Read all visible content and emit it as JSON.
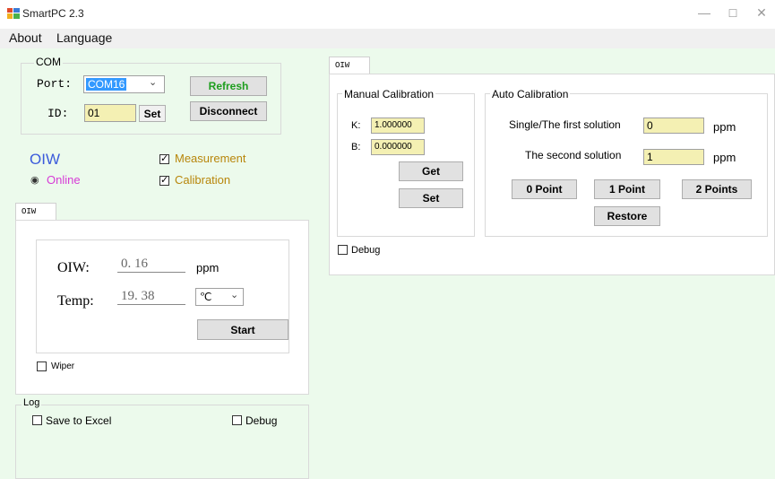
{
  "window": {
    "title": "SmartPC 2.3",
    "minimize_glyph": "—",
    "maximize_glyph": "☐",
    "close_glyph": "✕"
  },
  "menu": [
    "About",
    "Language"
  ],
  "com": {
    "group_label": "COM",
    "port_label": "Port:",
    "port_value": "COM16",
    "id_label": "ID:",
    "id_value": "01",
    "set_label": "Set",
    "refresh_label": "Refresh",
    "disconnect_label": "Disconnect"
  },
  "status": {
    "device_name": "OIW",
    "online_label": "Online",
    "measurement_label": "Measurement",
    "calibration_label": "Calibration"
  },
  "left_tab": {
    "tab_label": "OIW",
    "oiw_label": "OIW:",
    "oiw_value": "0. 16",
    "oiw_unit": "ppm",
    "temp_label": "Temp:",
    "temp_value": "19. 38",
    "temp_unit": "℃",
    "start_label": "Start",
    "wiper_label": "Wiper"
  },
  "log": {
    "group_label": "Log",
    "save_excel_label": "Save to Excel",
    "debug_label": "Debug"
  },
  "right_tab": {
    "tab_label": "OIW",
    "manual": {
      "group_label": "Manual Calibration",
      "k_label": "K:",
      "k_value": "1.000000",
      "b_label": "B:",
      "b_value": "0.000000",
      "get_label": "Get",
      "set_label": "Set"
    },
    "auto": {
      "group_label": "Auto Calibration",
      "first_label": "Single/The first solution",
      "first_value": "0",
      "first_unit": "ppm",
      "second_label": "The second solution",
      "second_value": "1",
      "second_unit": "ppm",
      "zero_point_label": "0 Point",
      "one_point_label": "1 Point",
      "two_points_label": "2 Points",
      "restore_label": "Restore"
    },
    "debug_label": "Debug"
  },
  "colors": {
    "client_bg": "#ecfaec",
    "device_name": "#3b5bdb",
    "online": "#d63bd6",
    "check_labels": "#b8860b",
    "refresh_text": "#1e9e1e",
    "field_yellow": "#f4f0b3"
  }
}
